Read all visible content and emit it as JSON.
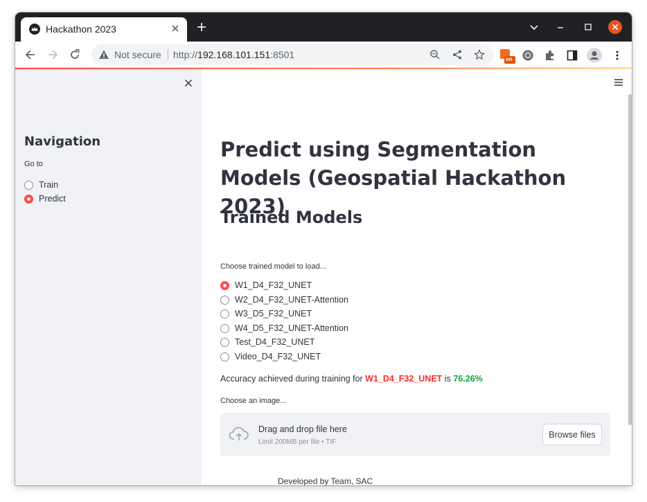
{
  "browser": {
    "tab_title": "Hackathon 2023",
    "not_secure_label": "Not secure",
    "url_scheme": "http://",
    "url_host": "192.168.101.151",
    "url_port": ":8501",
    "extension_badge": "on",
    "icons": [
      "favicon-crown-icon",
      "tab-close-icon",
      "new-tab-icon",
      "chevron-down-icon",
      "minimize-icon",
      "maximize-icon",
      "close-window-icon",
      "back-icon",
      "forward-icon",
      "reload-icon",
      "warning-icon",
      "zoom-icon",
      "share-icon",
      "star-icon",
      "extension-on-icon",
      "settings-gear-icon",
      "puzzle-icon",
      "side-panel-icon",
      "profile-icon",
      "kebab-menu-icon"
    ]
  },
  "sidebar": {
    "title": "Navigation",
    "radio_label": "Go to",
    "options": [
      {
        "label": "Train",
        "selected": false
      },
      {
        "label": "Predict",
        "selected": true
      }
    ]
  },
  "main": {
    "title": "Predict using Segmentation Models (Geospatial Hackathon 2023)",
    "subtitle": "Trained Models",
    "model_select_label": "Choose trained model to load...",
    "models": [
      {
        "label": "W1_D4_F32_UNET",
        "selected": true
      },
      {
        "label": "W2_D4_F32_UNET-Attention",
        "selected": false
      },
      {
        "label": "W3_D5_F32_UNET",
        "selected": false
      },
      {
        "label": "W4_D5_F32_UNET-Attention",
        "selected": false
      },
      {
        "label": "Test_D4_F32_UNET",
        "selected": false
      },
      {
        "label": "Video_D4_F32_UNET",
        "selected": false
      }
    ],
    "accuracy": {
      "prefix": "Accuracy achieved during training for",
      "model": "W1_D4_F32_UNET",
      "middle": "is",
      "value": "76.26%"
    },
    "image_label": "Choose an image...",
    "uploader": {
      "title": "Drag and drop file here",
      "limit": "Limit 200MB per file • TIF",
      "button": "Browse files"
    },
    "footer": "Developed by Team, SAC"
  },
  "colors": {
    "accent": "#ff4b4b",
    "sidebar_bg": "#f0f2f6",
    "text": "#31333f",
    "success": "#09ab3b"
  }
}
